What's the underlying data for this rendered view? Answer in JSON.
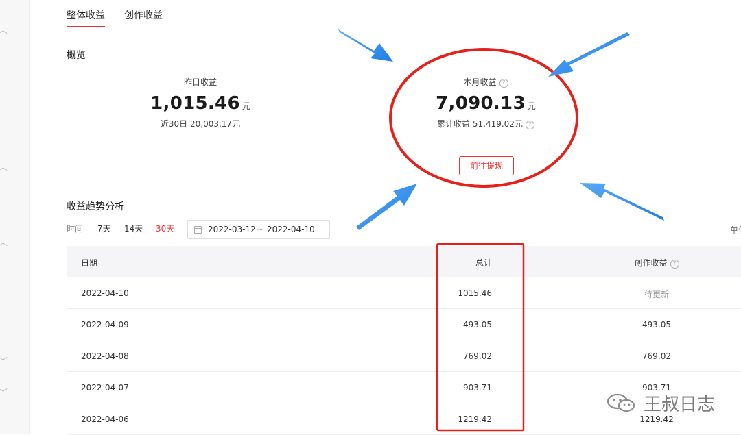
{
  "tabs": [
    {
      "label": "整体收益",
      "active": true
    },
    {
      "label": "创作收益",
      "active": false
    }
  ],
  "overview": {
    "title": "概览",
    "yesterday": {
      "label": "昨日收益",
      "value": "1,015.46",
      "unit": "元",
      "sub": "近30日 20,003.17元"
    },
    "month": {
      "label": "本月收益",
      "value": "7,090.13",
      "unit": "元",
      "sub": "累计收益 51,419.02元"
    },
    "withdraw_label": "前往提现"
  },
  "trend": {
    "title": "收益趋势分析",
    "time_label": "时间",
    "ranges": [
      {
        "label": "7天",
        "active": false
      },
      {
        "label": "14天",
        "active": false
      },
      {
        "label": "30天",
        "active": true
      }
    ],
    "date_start": "2022-03-12",
    "date_sep": "~",
    "date_end": "2022-04-10",
    "unit_label": "单位"
  },
  "table": {
    "headers": {
      "date": "日期",
      "total": "总计",
      "creation": "创作收益"
    },
    "rows": [
      {
        "date": "2022-04-10",
        "total": "1015.46",
        "creation": "待更新"
      },
      {
        "date": "2022-04-09",
        "total": "493.05",
        "creation": "493.05"
      },
      {
        "date": "2022-04-08",
        "total": "769.02",
        "creation": "769.02"
      },
      {
        "date": "2022-04-07",
        "total": "903.71",
        "creation": "903.71"
      },
      {
        "date": "2022-04-06",
        "total": "1219.42",
        "creation": "1219.42"
      }
    ]
  },
  "watermark": {
    "text": "王叔日志",
    "icon": "wechat-icon"
  },
  "colors": {
    "accent": "#e33333",
    "annotation_red": "#e8201a",
    "annotation_blue": "#2f8ff0"
  }
}
